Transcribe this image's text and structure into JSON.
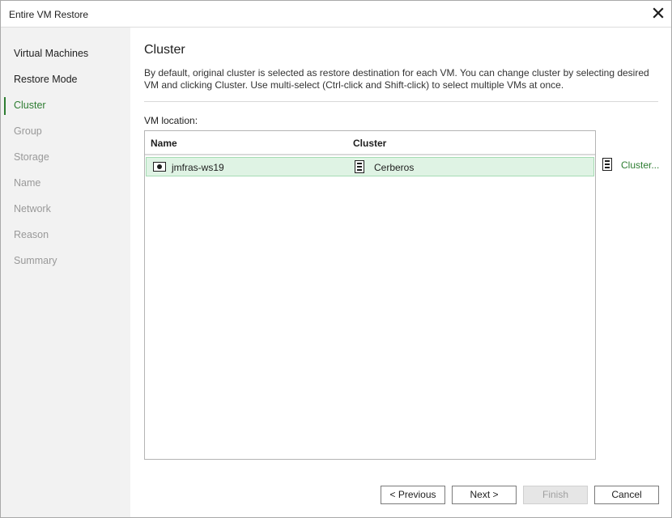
{
  "window": {
    "title": "Entire VM Restore"
  },
  "steps": [
    {
      "label": "Virtual Machines",
      "state": "done"
    },
    {
      "label": "Restore Mode",
      "state": "done"
    },
    {
      "label": "Cluster",
      "state": "active"
    },
    {
      "label": "Group",
      "state": "pending"
    },
    {
      "label": "Storage",
      "state": "pending"
    },
    {
      "label": "Name",
      "state": "pending"
    },
    {
      "label": "Network",
      "state": "pending"
    },
    {
      "label": "Reason",
      "state": "pending"
    },
    {
      "label": "Summary",
      "state": "pending"
    }
  ],
  "page": {
    "title": "Cluster",
    "description": "By default, original cluster is selected as restore destination for each VM. You can change cluster by selecting desired VM and clicking Cluster. Use multi-select (Ctrl-click and Shift-click) to select multiple VMs at once.",
    "vm_location_label": "VM location:"
  },
  "table": {
    "columns": [
      "Name",
      "Cluster"
    ],
    "rows": [
      {
        "name": "jmfras-ws19",
        "cluster": "Cerberos",
        "name_icon": "vm-icon",
        "cluster_icon": "cluster-icon"
      }
    ]
  },
  "actions": {
    "cluster_button": "Cluster...",
    "cluster_icon": "cluster-icon"
  },
  "buttons": {
    "previous": "< Previous",
    "next": "Next >",
    "finish": "Finish",
    "cancel": "Cancel"
  },
  "colors": {
    "accent": "#2e7d32",
    "selected_row": "#dff3e4",
    "sidebar_bg": "#f2f2f2"
  }
}
